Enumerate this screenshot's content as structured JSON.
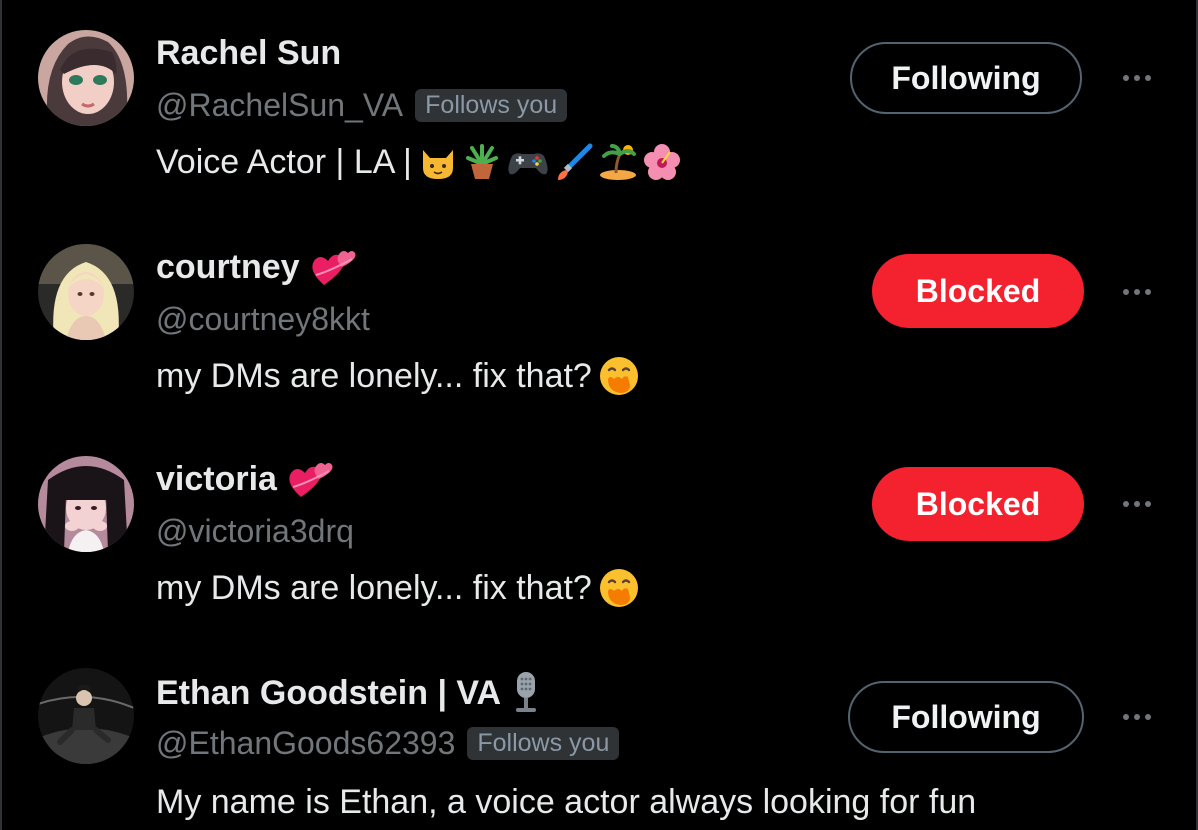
{
  "users": [
    {
      "display_name": "Rachel Sun",
      "handle": "@RachelSun_VA",
      "follows_you_badge": "Follows you",
      "bio_text": "Voice Actor | LA |",
      "bio_emojis": [
        "cat-face-emoji",
        "potted-plant-emoji",
        "game-controller-emoji",
        "paintbrush-emoji",
        "desert-island-emoji",
        "hibiscus-emoji"
      ],
      "action_label": "Following",
      "action_state": "following"
    },
    {
      "display_name": "courtney",
      "name_emoji": "two-hearts-emoji",
      "handle": "@courtney8kkt",
      "bio_text": "my DMs are lonely... fix that?",
      "bio_emojis": [
        "face-with-hand-over-mouth-emoji"
      ],
      "action_label": "Blocked",
      "action_state": "blocked"
    },
    {
      "display_name": "victoria",
      "name_emoji": "two-hearts-emoji",
      "handle": "@victoria3drq",
      "bio_text": "my DMs are lonely... fix that?",
      "bio_emojis": [
        "face-with-hand-over-mouth-emoji"
      ],
      "action_label": "Blocked",
      "action_state": "blocked"
    },
    {
      "display_name": "Ethan Goodstein | VA",
      "name_emoji": "microphone-emoji",
      "handle": "@EthanGoods62393",
      "follows_you_badge": "Follows you",
      "bio_text": "My name is Ethan, a voice actor always looking for fun",
      "action_label": "Following",
      "action_state": "following"
    }
  ],
  "colors": {
    "background": "#000000",
    "text_primary": "#e7e9ea",
    "text_secondary": "#71767b",
    "blocked_red": "#f4212e",
    "button_border": "#536471"
  }
}
